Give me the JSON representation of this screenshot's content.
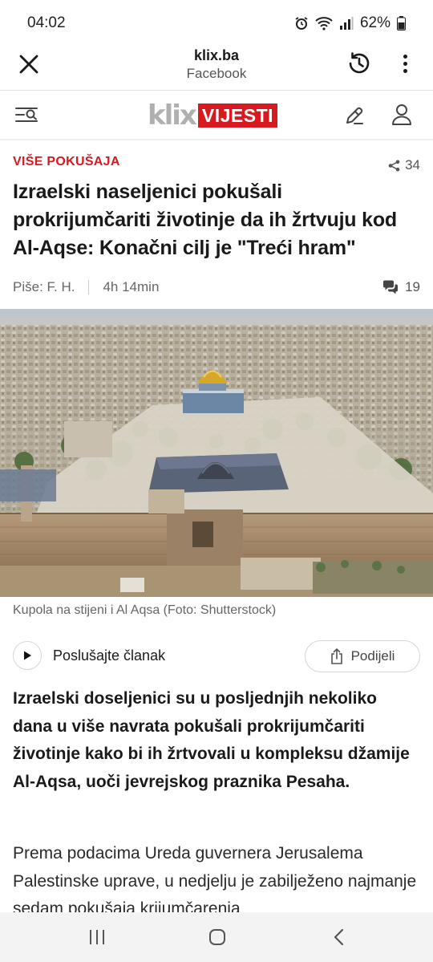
{
  "status_bar": {
    "time": "04:02",
    "battery": "62%"
  },
  "browser": {
    "domain": "klix.ba",
    "source": "Facebook"
  },
  "site": {
    "logo_text": "klix",
    "logo_badge": "VIJESTI",
    "logo_badge_color": "#d71920"
  },
  "article": {
    "category": "VIŠE POKUŠAJA",
    "share_count": "34",
    "headline": "Izraelski naseljenici pokušali prokrijumčariti životinje da ih žrtvuju kod Al-Aqse: Konačni cilj je \"Treći hram\"",
    "author": "Piše: F. H.",
    "time_ago": "4h 14min",
    "comment_count": "19",
    "image_caption": "Kupola na stijeni i Al Aqsa (Foto: Shutterstock)",
    "listen_label": "Poslušajte članak",
    "share_label": "Podijeli",
    "lead": "Izraelski doseljenici su u posljednjih nekoliko dana u više navrata pokušali prokrijumčariti životinje kako bi ih žrtvovali u kompleksu džamije Al-Aqsa, uoči jevrejskog praznika Pesaha.",
    "paragraph": "Prema podacima Ureda guvernera Jerusalema Palestinske uprave, u nedjelju je zabilježeno najmanje sedam pokušaja krijumčarenja"
  },
  "icons": {
    "close": "close-icon",
    "history": "history-icon",
    "more": "more-vertical-icon",
    "menu_search": "menu-search-icon",
    "pen": "pen-icon",
    "user": "user-icon",
    "share": "share-icon",
    "comment": "comment-icon",
    "play": "play-icon",
    "share_upload": "share-upload-icon"
  }
}
